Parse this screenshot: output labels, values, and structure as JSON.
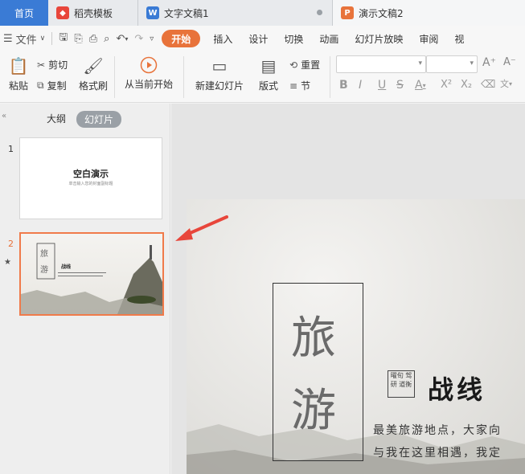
{
  "tabs": [
    {
      "label": "首页"
    },
    {
      "label": "稻壳模板",
      "icon": "daoke-icon",
      "color": "#e8463b"
    },
    {
      "label": "文字文稿1",
      "icon": "writer-icon",
      "color": "#3a7bd5"
    },
    {
      "label": "演示文稿2",
      "icon": "presentation-icon",
      "color": "#e8733b"
    }
  ],
  "menu": {
    "file_label": "文件",
    "items": [
      "开始",
      "插入",
      "设计",
      "切换",
      "动画",
      "幻灯片放映",
      "审阅",
      "视"
    ]
  },
  "ribbon": {
    "paste": "粘贴",
    "cut": "剪切",
    "copy": "复制",
    "format_painter": "格式刷",
    "play_from_current": "从当前开始",
    "new_slide": "新建幻灯片",
    "layout": "版式",
    "reset": "重置",
    "section": "节"
  },
  "panel": {
    "outline_tab": "大纲",
    "slides_tab": "幻灯片"
  },
  "thumbnails": [
    {
      "number": "1",
      "title": "空白演示",
      "subtitle": "单击输入您的封面副标题"
    },
    {
      "number": "2",
      "small_title": "战线",
      "chars": [
        "旅",
        "游"
      ]
    }
  ],
  "slide": {
    "char1": "旅",
    "char2": "游",
    "seal_text": "曜旬 驾研 道衡",
    "title": "战线",
    "line1": "最美旅游地点，大家向",
    "line2": "与我在这里相遇，我定"
  },
  "colors": {
    "accent": "#e8733b",
    "home_tab": "#3a7bd5",
    "selection": "#f07a4a",
    "arrow": "#e8463b"
  }
}
